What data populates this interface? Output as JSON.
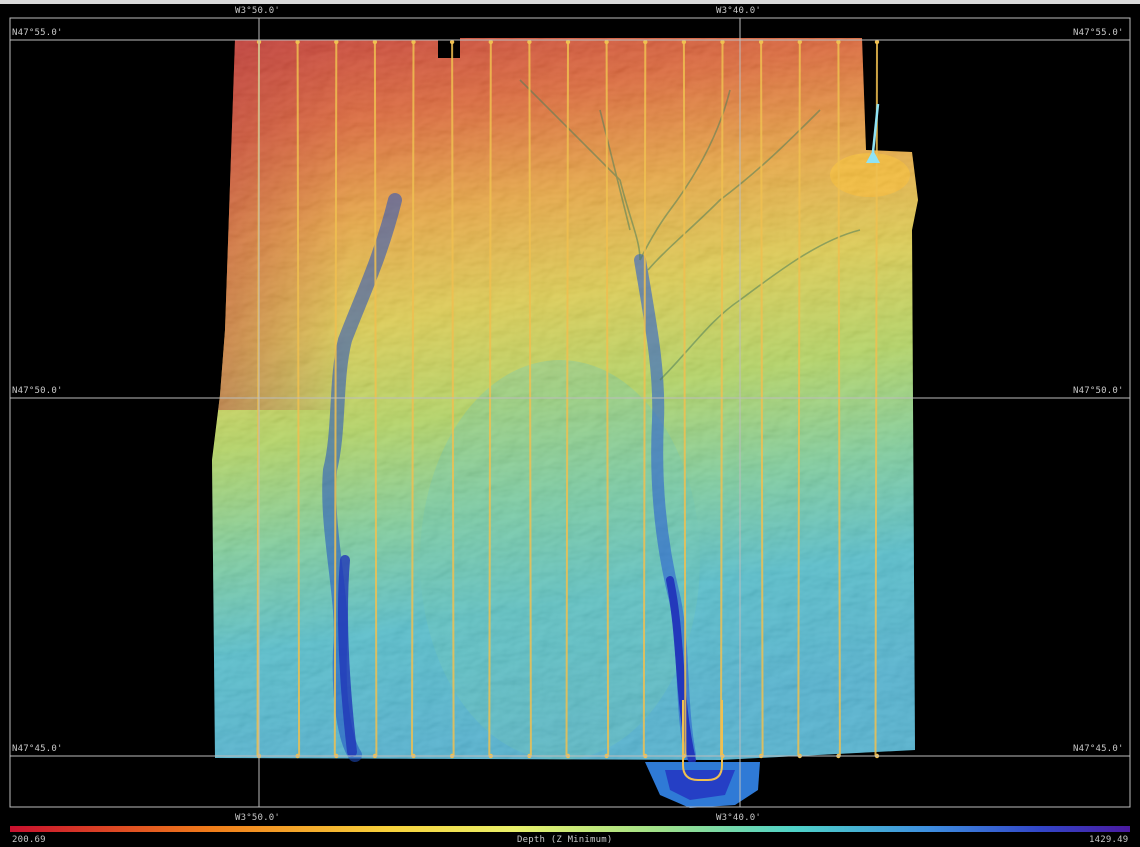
{
  "map": {
    "type": "bathymetry-grid",
    "colormap": [
      "#b80d18",
      "#e8561a",
      "#f2a52a",
      "#f4e23c",
      "#c6e04a",
      "#7ed27e",
      "#3fc6c9",
      "#2d78d8",
      "#1d2ab8",
      "#3a1070"
    ],
    "grid": {
      "longitudes": [
        {
          "label": "W3°50.0'",
          "position": "left"
        },
        {
          "label": "W3°40.0'",
          "position": "right"
        }
      ],
      "latitudes": [
        {
          "label": "N47°55.0'",
          "position": "north"
        },
        {
          "label": "N47°50.0'",
          "position": "middle"
        },
        {
          "label": "N47°45.0'",
          "position": "south"
        }
      ]
    },
    "survey_lines": {
      "color": "#f0c050",
      "count": 17,
      "pattern": "north-south parallel lines with a turn loop at the south end"
    },
    "vessel_marker": {
      "icon": "ship-position-arrow-icon",
      "color": "#8fe3f5"
    }
  },
  "colorbar": {
    "min_label": "200.69",
    "max_label": "1429.49",
    "title": "Depth (Z Minimum)",
    "stops": [
      "#c8102e",
      "#f07d1a",
      "#f7d23c",
      "#e9f06a",
      "#9fe08a",
      "#4fd2c8",
      "#3e8fe0",
      "#3246c8",
      "#4a1aa0"
    ]
  }
}
